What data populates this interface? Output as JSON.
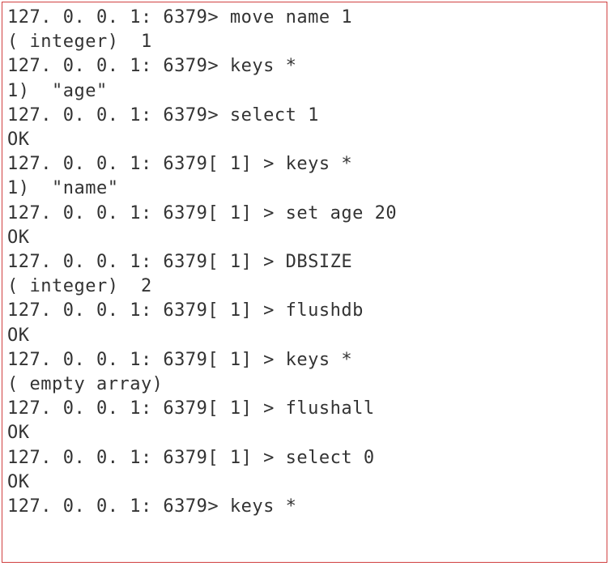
{
  "lines": [
    {
      "prompt": "127. 0. 0. 1: 6379>",
      "command": " move name 1"
    },
    {
      "output": "( integer)  1"
    },
    {
      "prompt": "127. 0. 0. 1: 6379>",
      "command": " keys *"
    },
    {
      "output": "1)  \"age\""
    },
    {
      "prompt": "127. 0. 0. 1: 6379>",
      "command": " select 1"
    },
    {
      "output": "OK"
    },
    {
      "prompt": "127. 0. 0. 1: 6379[ 1] >",
      "command": " keys *"
    },
    {
      "output": "1)  \"name\""
    },
    {
      "prompt": "127. 0. 0. 1: 6379[ 1] >",
      "command": " set age 20"
    },
    {
      "output": "OK"
    },
    {
      "prompt": "127. 0. 0. 1: 6379[ 1] >",
      "command": " DBSIZE"
    },
    {
      "output": "( integer)  2"
    },
    {
      "prompt": "127. 0. 0. 1: 6379[ 1] >",
      "command": " flushdb"
    },
    {
      "output": "OK"
    },
    {
      "prompt": "127. 0. 0. 1: 6379[ 1] >",
      "command": " keys *"
    },
    {
      "output": "( empty array)"
    },
    {
      "prompt": "127. 0. 0. 1: 6379[ 1] >",
      "command": " flushall"
    },
    {
      "output": "OK"
    },
    {
      "prompt": "127. 0. 0. 1: 6379[ 1] >",
      "command": " select 0"
    },
    {
      "output": "OK"
    },
    {
      "prompt": "127. 0. 0. 1: 6379>",
      "command": " keys *"
    }
  ]
}
